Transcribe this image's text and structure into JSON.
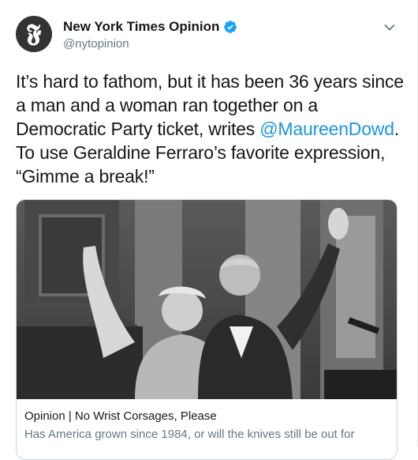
{
  "account": {
    "display_name": "New York Times Opinion",
    "handle": "@nytopinion",
    "avatar_glyph": "𝕱",
    "verified": true
  },
  "tweet": {
    "text_before": "It’s hard to fathom, but it has been 36 years since a man and a woman ran together on a Democratic Party ticket, writes ",
    "mention": "@MaureenDowd",
    "text_after": ". To use Geraldine Ferraro’s favorite expression, “Gimme a break!”"
  },
  "card": {
    "title": "Opinion | No Wrist Corsages, Please",
    "description": "Has America grown since 1984, or will the knives still be out for"
  },
  "colors": {
    "link": "#1b95e0",
    "verified_badge": "#1da1f2",
    "secondary_text": "#657786"
  },
  "icons": {
    "verified": "verified-badge-icon",
    "menu": "chevron-down-icon"
  }
}
